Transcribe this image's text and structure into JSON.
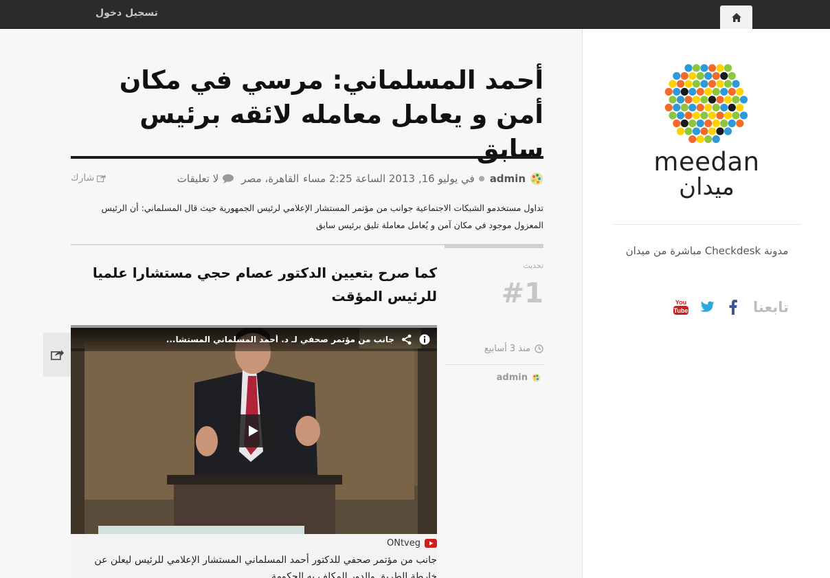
{
  "topbar": {
    "login_label": "تسجيل دخول",
    "home_icon": "home-icon"
  },
  "sidebar": {
    "logo_en": "meedan",
    "logo_ar": "ميدان",
    "description": "مدونة Checkdesk مباشرة من ميدان",
    "follow_label": "تابعنا",
    "social": [
      "facebook-icon",
      "twitter-icon",
      "youtube-icon"
    ]
  },
  "post": {
    "title": "أحمد المسلماني: مرسي في مكان أمن و يعامل معامله لائقه برئيس سابق",
    "author": "admin",
    "date": "في يوليو 16, 2013 الساعة 2:25 مساء",
    "location": "القاهرة، مصر",
    "comments": "لا تعليقات",
    "share": "شارك",
    "summary": "تداول مستخدمو الشبكات الاجتماعية جوانب من مؤتمر المستشار الإعلامي لرئيس الجمهورية حيث قال المسلماني: أن الرئيس المعزول موجود في مكان آمن و يُعامل معاملة تليق برئيس سابق"
  },
  "update": {
    "label": "تحديث",
    "number": "#1",
    "time_ago": "منذ 3 أسابيع",
    "author": "admin",
    "heading": "كما صرح بتعيين الدكتور عصام حجي مستشارا علميا للرئيس المؤقت",
    "video": {
      "title": "جانب من مؤتمر صحفي لـ د. أحمد المسلماني المستشا...",
      "source": "ONtveg",
      "description": "جانب من مؤتمر صحفي للدكتور أحمد المسلماني المستشار الإعلامي للرئيس ليعلن عن خارطة الطريق والدور المكلف به الحكومة"
    }
  },
  "colors": {
    "topbar": "#2b2b2b",
    "youtube": "#cc2020",
    "twitter": "#2aa9e0",
    "facebook": "#3b5998"
  }
}
